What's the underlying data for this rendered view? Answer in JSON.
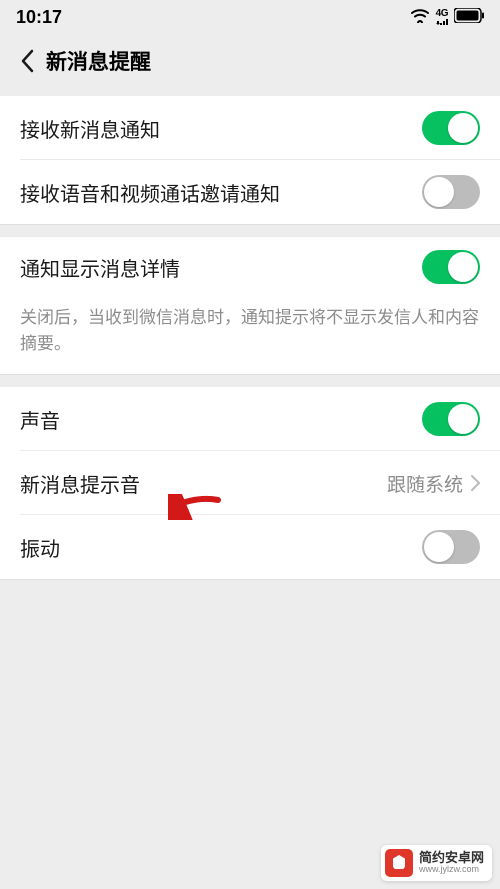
{
  "status": {
    "time": "10:17",
    "network_label": "4G"
  },
  "header": {
    "title": "新消息提醒"
  },
  "settings": {
    "receive_message": {
      "label": "接收新消息通知",
      "on": true
    },
    "receive_call": {
      "label": "接收语音和视频通话邀请通知",
      "on": false
    },
    "show_detail": {
      "label": "通知显示消息详情",
      "on": true,
      "desc": "关闭后，当收到微信消息时，通知提示将不显示发信人和内容摘要。"
    },
    "sound": {
      "label": "声音",
      "on": true
    },
    "ringtone": {
      "label": "新消息提示音",
      "value": "跟随系统"
    },
    "vibrate": {
      "label": "振动",
      "on": false
    }
  },
  "watermark": {
    "title": "简约安卓网",
    "url": "www.jylzw.com"
  }
}
